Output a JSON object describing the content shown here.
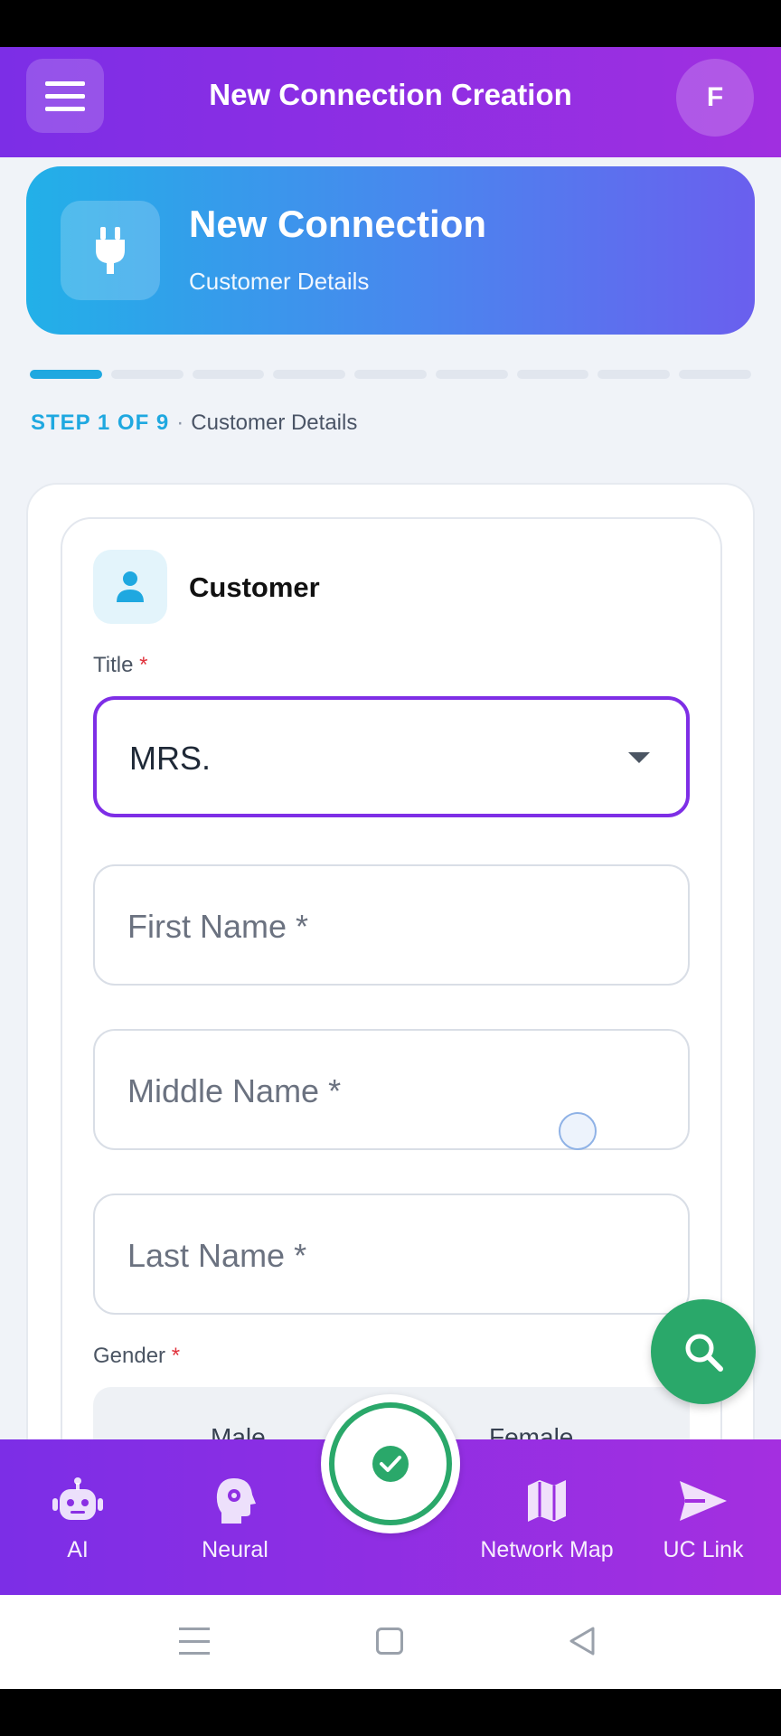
{
  "app_bar": {
    "title": "New Connection Creation",
    "avatar_initial": "F"
  },
  "banner": {
    "title": "New Connection",
    "subtitle": "Customer Details",
    "icon": "plug-icon"
  },
  "progress": {
    "current_step": 1,
    "total_steps": 9
  },
  "step": {
    "label": "STEP 1 OF 9",
    "separator": "·",
    "name": "Customer Details"
  },
  "section": {
    "title": "Customer",
    "icon": "person-icon"
  },
  "form": {
    "title_label": "Title",
    "required_mark": "*",
    "title_value": "MRS.",
    "first_name_placeholder": "First Name *",
    "middle_name_placeholder": "Middle Name *",
    "last_name_placeholder": "Last Name *",
    "gender_label": "Gender",
    "gender_options": [
      "Male",
      "Female"
    ]
  },
  "bottom_nav": {
    "items": [
      {
        "label": "AI",
        "icon": "robot-icon"
      },
      {
        "label": "Neural",
        "icon": "brain-head-icon"
      },
      {
        "label": "Network Map",
        "icon": "map-icon"
      },
      {
        "label": "UC Link",
        "icon": "send-icon"
      }
    ]
  },
  "colors": {
    "primary_purple": "#7c2ee6",
    "accent_blue": "#1fa8e0",
    "success_green": "#2aa86a",
    "required_red": "#e0323c"
  }
}
